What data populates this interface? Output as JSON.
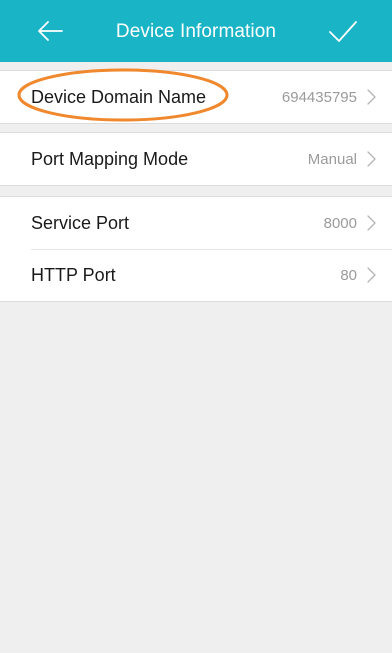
{
  "header": {
    "back_icon": "arrow-left-icon",
    "title": "Device Information",
    "confirm_icon": "checkmark-icon",
    "background_color": "#1ab4c7"
  },
  "groups": [
    {
      "rows": [
        {
          "label": "Device Domain Name",
          "value": "694435795",
          "icon": "chevron-right-icon",
          "highlighted": true
        }
      ]
    },
    {
      "rows": [
        {
          "label": "Port Mapping Mode",
          "value": "Manual",
          "icon": "chevron-right-icon"
        }
      ]
    },
    {
      "rows": [
        {
          "label": "Service Port",
          "value": "8000",
          "icon": "chevron-right-icon"
        },
        {
          "label": "HTTP Port",
          "value": "80",
          "icon": "chevron-right-icon"
        }
      ]
    }
  ],
  "annotation": {
    "color": "#f0882e",
    "target": "Device Domain Name"
  }
}
